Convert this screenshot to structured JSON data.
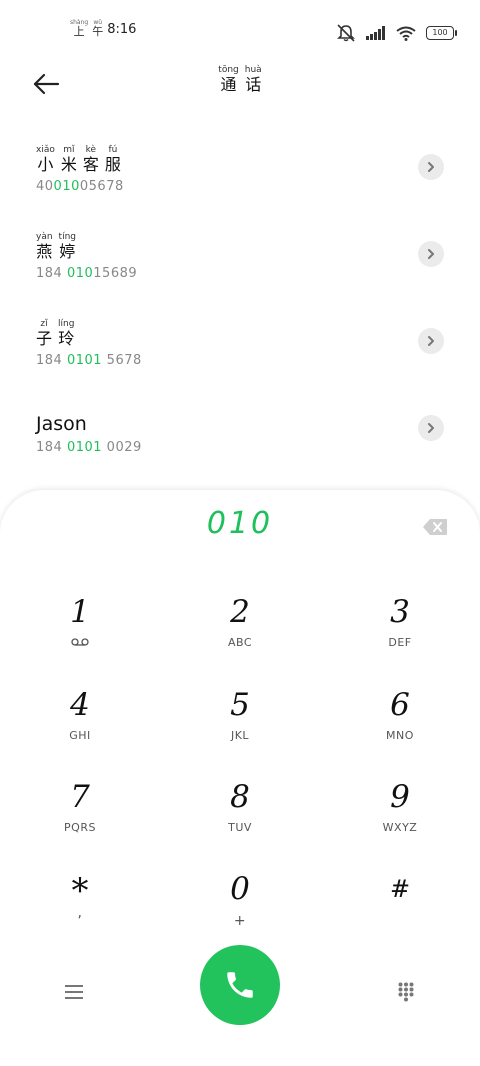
{
  "status_bar": {
    "ampm_pinyin": [
      "shàng",
      "wǔ"
    ],
    "ampm_chars": [
      "上",
      "午"
    ],
    "time": "8:16",
    "battery": "100",
    "icons": [
      "mute-icon",
      "signal-icon",
      "wifi-icon",
      "battery-icon"
    ]
  },
  "header": {
    "title_pinyin": [
      "tōng",
      "huà"
    ],
    "title_chars": [
      "通",
      "话"
    ],
    "back_icon": "arrow-left-icon"
  },
  "contacts": [
    {
      "name_pinyin": [
        "xiǎo",
        "mǐ",
        "kè",
        "fú"
      ],
      "name_chars": [
        "小",
        "米",
        "客",
        "服"
      ],
      "number_pre": "40",
      "number_hl": "010",
      "number_post": "05678"
    },
    {
      "name_pinyin": [
        "yàn",
        "tíng"
      ],
      "name_chars": [
        "燕",
        "婷"
      ],
      "number_pre": "184 ",
      "number_hl": "010",
      "number_post": "15689"
    },
    {
      "name_pinyin": [
        "zǐ",
        "líng"
      ],
      "name_chars": [
        "子",
        "玲"
      ],
      "number_pre": "184 ",
      "number_hl": "0101",
      "number_post": " 5678"
    },
    {
      "name": "Jason",
      "number_pre": "184 ",
      "number_hl": "0101",
      "number_post": " 0029"
    }
  ],
  "dialpad": {
    "input": "010",
    "keys": [
      {
        "digit": "1",
        "letters": ""
      },
      {
        "digit": "2",
        "letters": "ABC"
      },
      {
        "digit": "3",
        "letters": "DEF"
      },
      {
        "digit": "4",
        "letters": "GHI"
      },
      {
        "digit": "5",
        "letters": "JKL"
      },
      {
        "digit": "6",
        "letters": "MNO"
      },
      {
        "digit": "7",
        "letters": "PQRS"
      },
      {
        "digit": "8",
        "letters": "TUV"
      },
      {
        "digit": "9",
        "letters": "WXYZ"
      },
      {
        "digit": "*",
        "letters": ","
      },
      {
        "digit": "0",
        "letters": "+"
      },
      {
        "digit": "#",
        "letters": ""
      }
    ]
  },
  "colors": {
    "accent": "#1fbf5b",
    "call_button": "#22c25d"
  }
}
